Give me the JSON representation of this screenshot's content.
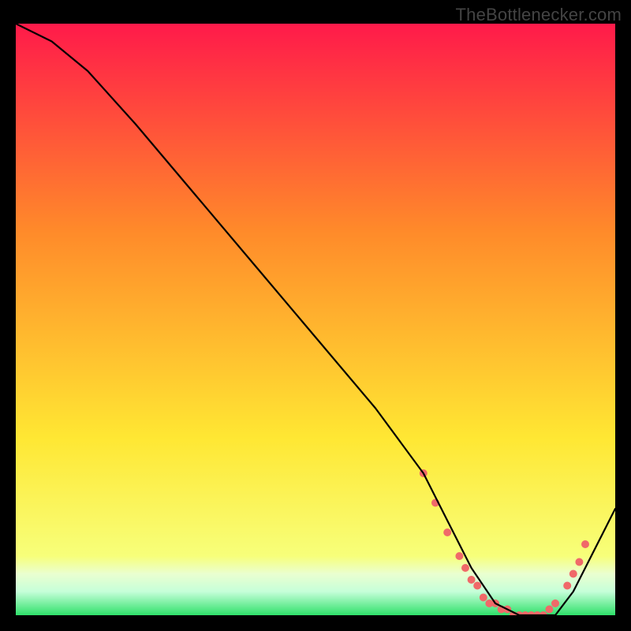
{
  "watermark": "TheBottlenecker.com",
  "chart_data": {
    "type": "line",
    "title": "",
    "xlabel": "",
    "ylabel": "",
    "xlim": [
      0,
      100
    ],
    "ylim": [
      0,
      100
    ],
    "gradient_background": {
      "top": "#ff1a4a",
      "mid1": "#ff8a2a",
      "mid2": "#ffe733",
      "bottom_band": "#eaffd0",
      "base_line": "#2fe06a"
    },
    "series": [
      {
        "name": "bottleneck-curve",
        "color": "#000000",
        "x": [
          0,
          6,
          12,
          20,
          30,
          40,
          50,
          60,
          68,
          72,
          76,
          80,
          84,
          87,
          90,
          93,
          96,
          100
        ],
        "y": [
          100,
          97,
          92,
          83,
          71,
          59,
          47,
          35,
          24,
          16,
          8,
          2,
          0,
          0,
          0,
          4,
          10,
          18
        ]
      }
    ],
    "marker_points": {
      "color": "#f06969",
      "radius": 5,
      "x": [
        68,
        70,
        72,
        74,
        75,
        76,
        77,
        78,
        79,
        80,
        81,
        82,
        83,
        84,
        85,
        86,
        87,
        88,
        89,
        90,
        92,
        93,
        94,
        95
      ],
      "y": [
        24,
        19,
        14,
        10,
        8,
        6,
        5,
        3,
        2,
        2,
        1,
        1,
        0,
        0,
        0,
        0,
        0,
        0,
        1,
        2,
        5,
        7,
        9,
        12
      ]
    }
  }
}
